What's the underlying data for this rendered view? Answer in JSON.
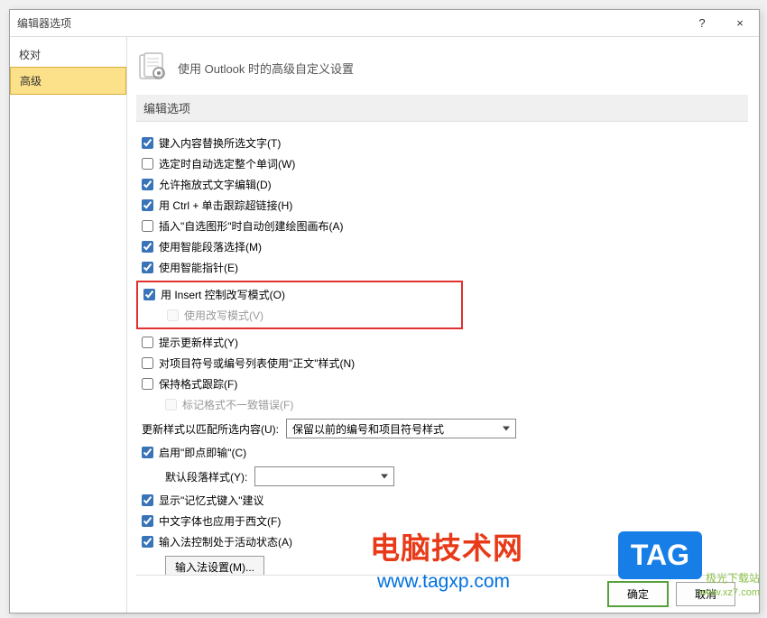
{
  "title": "编辑器选项",
  "titlebar": {
    "help_label": "?",
    "close_label": "×"
  },
  "nav": {
    "items": [
      {
        "label": "校对"
      },
      {
        "label": "高级"
      }
    ],
    "selected_index": 1
  },
  "header": {
    "text": "使用 Outlook 时的高级自定义设置"
  },
  "section_title": "编辑选项",
  "options": {
    "o1": {
      "label": "键入内容替换所选文字(T)",
      "checked": true
    },
    "o2": {
      "label": "选定时自动选定整个单词(W)",
      "checked": false
    },
    "o3": {
      "label": "允许拖放式文字编辑(D)",
      "checked": true
    },
    "o4": {
      "label": "用 Ctrl + 单击跟踪超链接(H)",
      "checked": true
    },
    "o5": {
      "label": "插入\"自选图形\"时自动创建绘图画布(A)",
      "checked": false
    },
    "o6": {
      "label": "使用智能段落选择(M)",
      "checked": true
    },
    "o7": {
      "label": "使用智能指针(E)",
      "checked": true
    },
    "o8": {
      "label": "用 Insert 控制改写模式(O)",
      "checked": true
    },
    "o8a": {
      "label": "使用改写模式(V)",
      "checked": false
    },
    "o9": {
      "label": "提示更新样式(Y)",
      "checked": false
    },
    "o10": {
      "label": "对项目符号或编号列表使用\"正文\"样式(N)",
      "checked": false
    },
    "o11": {
      "label": "保持格式跟踪(F)",
      "checked": false
    },
    "o11a": {
      "label": "标记格式不一致错误(F)",
      "checked": false
    },
    "style_update": {
      "label": "更新样式以匹配所选内容(U):",
      "value": "保留以前的编号和项目符号样式"
    },
    "o12": {
      "label": "启用\"即点即输\"(C)",
      "checked": true
    },
    "default_para": {
      "label": "默认段落样式(Y):",
      "value": ""
    },
    "o13": {
      "label": "显示\"记忆式键入\"建议",
      "checked": true
    },
    "o14": {
      "label": "中文字体也应用于西文(F)",
      "checked": true
    },
    "o15": {
      "label": "输入法控制处于活动状态(A)",
      "checked": true
    },
    "ime_btn": "输入法设置(M)..."
  },
  "footer": {
    "ok": "确定",
    "cancel": "取消"
  },
  "watermarks": {
    "w1": "电脑技术网",
    "w1url": "www.tagxp.com",
    "tag": "TAG",
    "w2": "极光下载站",
    "w2url": "www.xz7.com"
  }
}
